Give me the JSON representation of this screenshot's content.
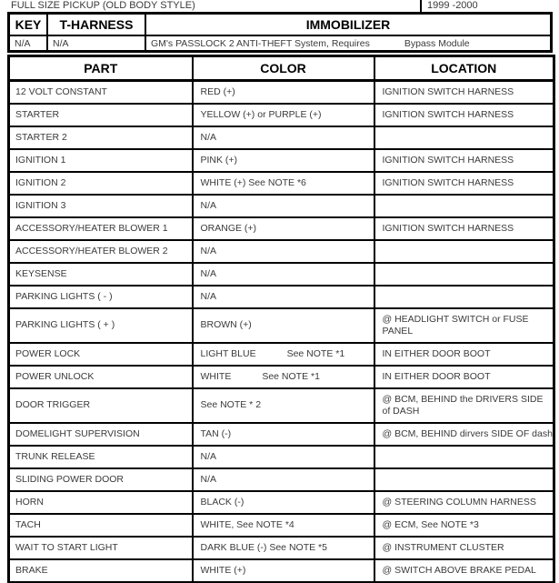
{
  "header": {
    "vehicle": "FULL SIZE PICKUP (OLD BODY STYLE)",
    "years": "1999 -2000"
  },
  "immobilizer": {
    "key_label": "KEY",
    "harness_label": "T-HARNESS",
    "immobilizer_label": "IMMOBILIZER",
    "key_value": "N/A",
    "harness_value": "N/A",
    "immobilizer_value": "GM's PASSLOCK 2 ANTI-THEFT System, Requires",
    "immobilizer_value_2": "Bypass Module"
  },
  "table": {
    "columns": [
      "PART",
      "COLOR",
      "LOCATION"
    ],
    "rows": [
      {
        "part": "12 VOLT CONSTANT",
        "color": "RED (+)",
        "location": "IGNITION SWITCH HARNESS"
      },
      {
        "part": "STARTER",
        "color": "YELLOW (+) or PURPLE (+)",
        "location": "IGNITION SWITCH HARNESS"
      },
      {
        "part": "STARTER 2",
        "color": "N/A",
        "location": ""
      },
      {
        "part": "IGNITION 1",
        "color": "PINK (+)",
        "location": "IGNITION SWITCH HARNESS"
      },
      {
        "part": "IGNITION 2",
        "color": "WHITE (+) See NOTE *6",
        "location": "IGNITION SWITCH HARNESS"
      },
      {
        "part": "IGNITION 3",
        "color": "N/A",
        "location": ""
      },
      {
        "part": "ACCESSORY/HEATER BLOWER 1",
        "color": "ORANGE (+)",
        "location": "IGNITION SWITCH HARNESS"
      },
      {
        "part": "ACCESSORY/HEATER BLOWER 2",
        "color": "N/A",
        "location": ""
      },
      {
        "part": "KEYSENSE",
        "color": "N/A",
        "location": ""
      },
      {
        "part": "PARKING LIGHTS ( - )",
        "color": "N/A",
        "location": ""
      },
      {
        "part": "PARKING LIGHTS ( + )",
        "color": "BROWN (+)",
        "location": "@ HEADLIGHT SWITCH or FUSE PANEL",
        "tall": true
      },
      {
        "part": "POWER LOCK",
        "color": "LIGHT BLUE",
        "color_note": "See NOTE *1",
        "location": "IN EITHER DOOR BOOT"
      },
      {
        "part": "POWER UNLOCK",
        "color": "WHITE",
        "color_note": "See NOTE *1",
        "location": "IN EITHER DOOR BOOT"
      },
      {
        "part": "DOOR TRIGGER",
        "color": "See NOTE * 2",
        "location": "@ BCM, BEHIND the DRIVERS SIDE of DASH",
        "tall": true
      },
      {
        "part": "DOMELIGHT SUPERVISION",
        "color": "TAN (-)",
        "location": "@ BCM, BEHIND dirvers SIDE OF dash"
      },
      {
        "part": "TRUNK RELEASE",
        "color": "N/A",
        "location": ""
      },
      {
        "part": "SLIDING POWER DOOR",
        "color": "N/A",
        "location": ""
      },
      {
        "part": "HORN",
        "color": "BLACK (-)",
        "location": "@ STEERING COLUMN HARNESS"
      },
      {
        "part": "TACH",
        "color": "WHITE, See NOTE *4",
        "location": "@ ECM, See NOTE *3"
      },
      {
        "part": "WAIT TO START LIGHT",
        "color": "DARK BLUE (-) See NOTE *5",
        "location": "@ INSTRUMENT CLUSTER"
      },
      {
        "part": "BRAKE",
        "color": "WHITE (+)",
        "location": "@ SWITCH ABOVE BRAKE PEDAL"
      }
    ]
  },
  "colors": {
    "border": "#000000",
    "text": "#3a3a3a",
    "heading": "#000000",
    "background": "#ffffff"
  }
}
